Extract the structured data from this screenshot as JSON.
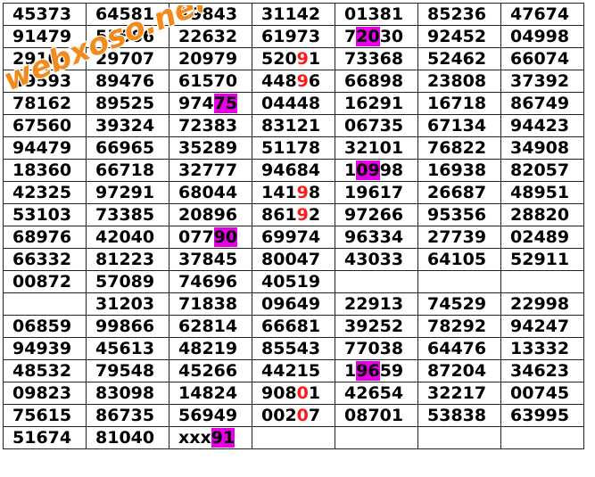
{
  "logo": {
    "text": "webxoso.net",
    "color": "#f28a1c"
  },
  "highlight_colors": {
    "magenta": "#e600e6",
    "red": "#ff1a1a"
  },
  "rows": [
    [
      {
        "t": "45373"
      },
      {
        "t": "64581"
      },
      {
        "t": "79843"
      },
      {
        "t": "31142"
      },
      {
        "t": "01381"
      },
      {
        "t": "85236"
      },
      {
        "t": "47674"
      }
    ],
    [
      {
        "t": "91479"
      },
      {
        "t": "55666"
      },
      {
        "t": "22632"
      },
      {
        "t": "61973"
      },
      {
        "t": "72030",
        "hl": "20",
        "hs": "magenta"
      },
      {
        "t": "92452"
      },
      {
        "t": "04998"
      }
    ],
    [
      {
        "t": "29104"
      },
      {
        "t": "29707"
      },
      {
        "t": "20979"
      },
      {
        "t": "52091",
        "hl": "9",
        "hs": "red"
      },
      {
        "t": "73368"
      },
      {
        "t": "52462"
      },
      {
        "t": "66074"
      }
    ],
    [
      {
        "t": "49593"
      },
      {
        "t": "89476"
      },
      {
        "t": "61570"
      },
      {
        "t": "44896",
        "hl": "9",
        "hs": "red"
      },
      {
        "t": "66898"
      },
      {
        "t": "23808"
      },
      {
        "t": "37392"
      }
    ],
    [
      {
        "t": "78162"
      },
      {
        "t": "89525"
      },
      {
        "t": "97475",
        "hl": "75",
        "hs": "magenta"
      },
      {
        "t": "04448"
      },
      {
        "t": "16291"
      },
      {
        "t": "16718"
      },
      {
        "t": "86749"
      }
    ],
    [
      {
        "t": "67560"
      },
      {
        "t": "39324"
      },
      {
        "t": "72383"
      },
      {
        "t": "83121"
      },
      {
        "t": "06735"
      },
      {
        "t": "67134"
      },
      {
        "t": "94423"
      }
    ],
    [
      {
        "t": "94479"
      },
      {
        "t": "66965"
      },
      {
        "t": "35289"
      },
      {
        "t": "51178"
      },
      {
        "t": "32101"
      },
      {
        "t": "76822"
      },
      {
        "t": "34908"
      }
    ],
    [
      {
        "t": "18360"
      },
      {
        "t": "66718"
      },
      {
        "t": "32777"
      },
      {
        "t": "94684"
      },
      {
        "t": "10998",
        "hl": "09",
        "hs": "magenta"
      },
      {
        "t": "16938"
      },
      {
        "t": "82057"
      }
    ],
    [
      {
        "t": "42325"
      },
      {
        "t": "97291"
      },
      {
        "t": "68044"
      },
      {
        "t": "14198",
        "hl": "9",
        "hs": "red"
      },
      {
        "t": "19617"
      },
      {
        "t": "26687"
      },
      {
        "t": "48951"
      }
    ],
    [
      {
        "t": "53103"
      },
      {
        "t": "73385"
      },
      {
        "t": "20896"
      },
      {
        "t": "86192",
        "hl": "9",
        "hs": "red"
      },
      {
        "t": "97266"
      },
      {
        "t": "95356"
      },
      {
        "t": "28820"
      }
    ],
    [
      {
        "t": "68976"
      },
      {
        "t": "42040"
      },
      {
        "t": "07790",
        "hl": "90",
        "hs": "magenta"
      },
      {
        "t": "69974"
      },
      {
        "t": "96334"
      },
      {
        "t": "27739"
      },
      {
        "t": "02489"
      }
    ],
    [
      {
        "t": "66332"
      },
      {
        "t": "81223"
      },
      {
        "t": "37845"
      },
      {
        "t": "80047"
      },
      {
        "t": "43033"
      },
      {
        "t": "64105"
      },
      {
        "t": "52911"
      }
    ],
    [
      {
        "t": "00872"
      },
      {
        "t": "57089"
      },
      {
        "t": "74696"
      },
      {
        "t": "40519"
      },
      {
        "t": ""
      },
      {
        "t": ""
      },
      {
        "t": ""
      }
    ],
    [
      {
        "t": ""
      },
      {
        "t": "31203"
      },
      {
        "t": "71838"
      },
      {
        "t": "09649"
      },
      {
        "t": "22913"
      },
      {
        "t": "74529"
      },
      {
        "t": "22998"
      }
    ],
    [
      {
        "t": "06859"
      },
      {
        "t": "99866"
      },
      {
        "t": "62814"
      },
      {
        "t": "66681"
      },
      {
        "t": "39252"
      },
      {
        "t": "78292"
      },
      {
        "t": "94247"
      }
    ],
    [
      {
        "t": "94939"
      },
      {
        "t": "45613"
      },
      {
        "t": "48219"
      },
      {
        "t": "85543"
      },
      {
        "t": "77038"
      },
      {
        "t": "64476"
      },
      {
        "t": "13332"
      }
    ],
    [
      {
        "t": "48532"
      },
      {
        "t": "79548"
      },
      {
        "t": "45266"
      },
      {
        "t": "44215"
      },
      {
        "t": "19659",
        "hl": "96",
        "hs": "magenta"
      },
      {
        "t": "87204"
      },
      {
        "t": "34623"
      }
    ],
    [
      {
        "t": "09823"
      },
      {
        "t": "83098"
      },
      {
        "t": "14824"
      },
      {
        "t": "90801",
        "hl": "0",
        "hs": "red"
      },
      {
        "t": "42654"
      },
      {
        "t": "32217"
      },
      {
        "t": "00745"
      }
    ],
    [
      {
        "t": "75615"
      },
      {
        "t": "86735"
      },
      {
        "t": "56949"
      },
      {
        "t": "00207",
        "hl": "0",
        "hs": "red"
      },
      {
        "t": "08701"
      },
      {
        "t": "53838"
      },
      {
        "t": "63995"
      }
    ],
    [
      {
        "t": "51674"
      },
      {
        "t": "81040"
      },
      {
        "t": "xxx91",
        "hl": "91",
        "hs": "magenta"
      },
      {
        "t": ""
      },
      {
        "t": ""
      },
      {
        "t": ""
      },
      {
        "t": ""
      }
    ]
  ]
}
